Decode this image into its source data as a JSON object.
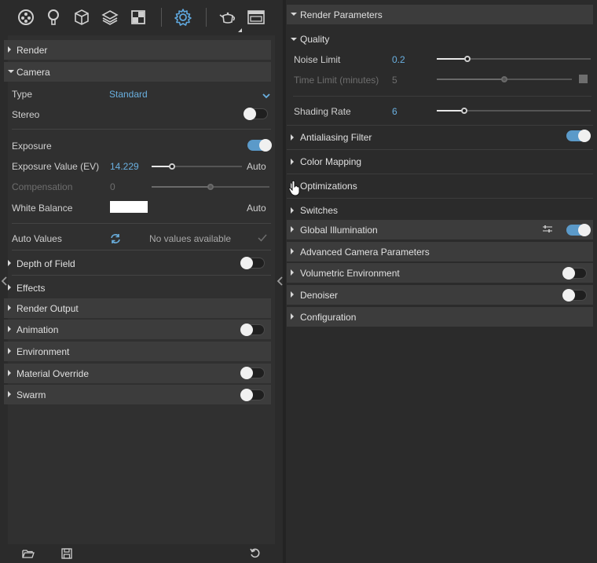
{
  "left": {
    "toolbar": {
      "icons": [
        "scene-icon",
        "lightbulb-icon",
        "cube-icon",
        "layers-icon",
        "texture-icon",
        "gear-icon",
        "teapot-icon",
        "window-icon"
      ]
    },
    "sections": {
      "render": "Render",
      "camera": "Camera",
      "depth_of_field": "Depth of Field",
      "effects": "Effects",
      "render_output": "Render Output",
      "animation": "Animation",
      "environment": "Environment",
      "material_override": "Material Override",
      "swarm": "Swarm"
    },
    "camera": {
      "type_label": "Type",
      "type_value": "Standard",
      "stereo_label": "Stereo",
      "stereo_on": false,
      "exposure_label": "Exposure",
      "exposure_on": true,
      "ev_label": "Exposure Value (EV)",
      "ev_value": "14.229",
      "ev_fraction": 0.23,
      "ev_auto": "Auto",
      "comp_label": "Compensation",
      "comp_value": "0",
      "comp_fraction": 0.5,
      "wb_label": "White Balance",
      "wb_color": "#ffffff",
      "wb_auto": "Auto",
      "auto_values_label": "Auto Values",
      "auto_values_status": "No values available"
    },
    "toggles": {
      "depth_of_field": false,
      "animation": false,
      "material_override": false,
      "swarm": false
    }
  },
  "right": {
    "render_parameters": "Render Parameters",
    "quality": "Quality",
    "noise_limit_label": "Noise Limit",
    "noise_limit_value": "0.2",
    "noise_limit_fraction": 0.2,
    "time_limit_label": "Time Limit (minutes)",
    "time_limit_value": "5",
    "time_limit_fraction": 0.5,
    "shading_rate_label": "Shading Rate",
    "shading_rate_value": "6",
    "shading_rate_fraction": 0.18,
    "antialiasing_filter": "Antialiasing Filter",
    "antialiasing_on": true,
    "color_mapping": "Color Mapping",
    "optimizations": "Optimizations",
    "switches": "Switches",
    "global_illumination": "Global Illumination",
    "global_illumination_on": true,
    "advanced_camera": "Advanced Camera Parameters",
    "volumetric_environment": "Volumetric Environment",
    "volumetric_on": false,
    "denoiser": "Denoiser",
    "denoiser_on": false,
    "configuration": "Configuration"
  },
  "colors": {
    "accent": "#6ab0e0",
    "toggle_on": "#5b9ac9",
    "section_bg": "#3c3c3c",
    "panel_bg": "#2b2b2b"
  }
}
